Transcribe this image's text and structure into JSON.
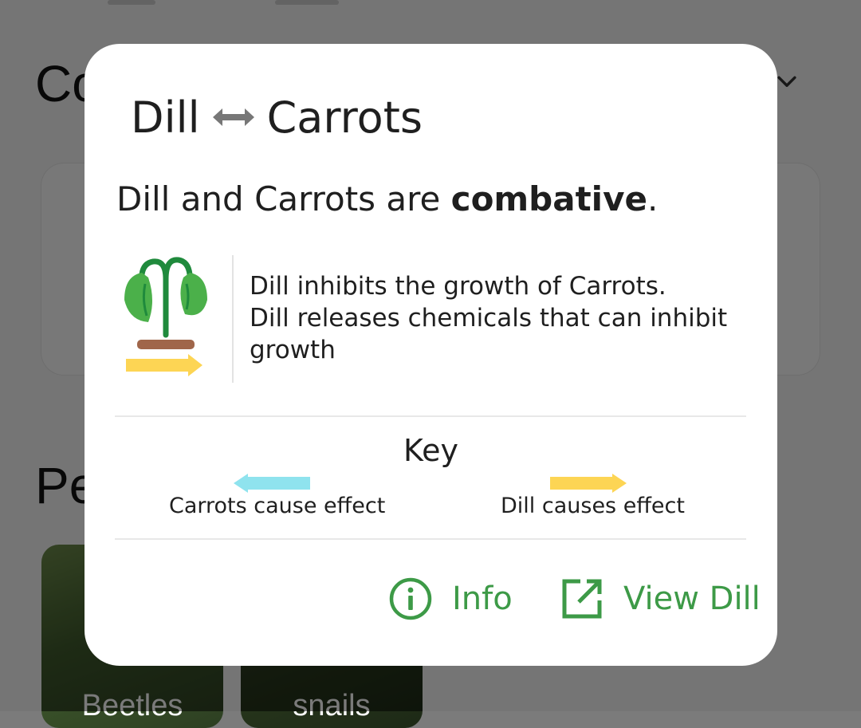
{
  "background": {
    "heading_1": "Co",
    "heading_2": "Pe",
    "tiles": [
      {
        "label": "Beetles"
      },
      {
        "label": "snails"
      }
    ]
  },
  "dialog": {
    "title_left": "Dill",
    "title_right": "Carrots",
    "statement_prefix": "Dill and Carrots are ",
    "statement_relation": "combative",
    "statement_suffix": ".",
    "description_line_1": "Dill inhibits the growth of Carrots.",
    "description_line_2": "Dill releases chemicals that can inhibit growth",
    "key": {
      "title": "Key",
      "left_label": "Carrots cause effect",
      "right_label": "Dill causes effect"
    },
    "actions": {
      "info_label": "Info",
      "view_label": "View Dill"
    }
  },
  "colors": {
    "accent": "#3d9a47",
    "arrow_left": "#8fe3ee",
    "arrow_right": "#fdd554",
    "plant_leaf": "#4bb04a",
    "plant_stem": "#1f8a3c",
    "soil": "#a0664a"
  },
  "icons": {
    "swap": "left-right-arrow-icon",
    "info": "info-circle-icon",
    "open": "open-in-new-icon",
    "chevron": "chevron-down-icon"
  }
}
